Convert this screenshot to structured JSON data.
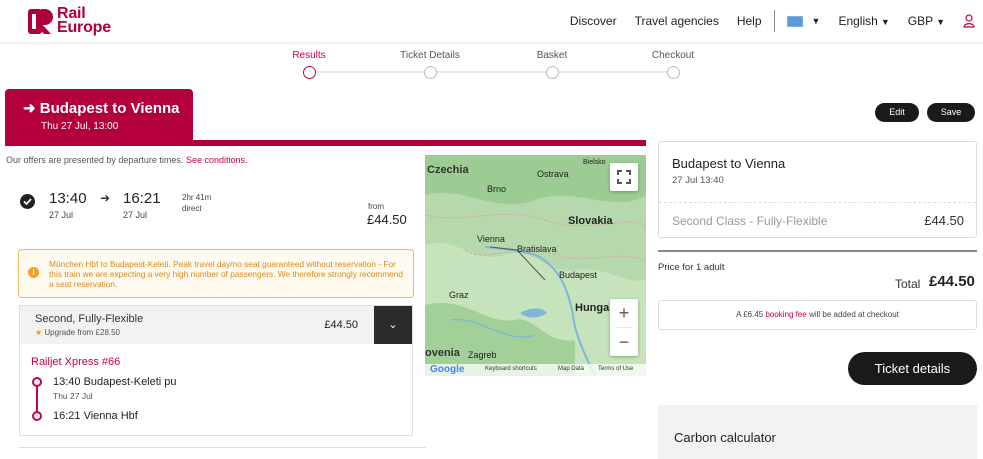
{
  "header": {
    "logo_line1": "Rail",
    "logo_line2": "Europe",
    "nav": [
      "Discover",
      "Travel agencies",
      "Help"
    ],
    "language": "English",
    "currency": "GBP"
  },
  "progress": {
    "steps": [
      "Results",
      "Ticket Details",
      "Basket",
      "Checkout"
    ],
    "active_index": 0
  },
  "journey": {
    "title": "Budapest to Vienna",
    "subtitle": "Thu 27 Jul, 13:00"
  },
  "offers_note": {
    "text": "Our offers are presented by departure times.",
    "link": "See conditions."
  },
  "train": {
    "dep_time": "13:40",
    "dep_date": "27 Jul",
    "arr_time": "16:21",
    "arr_date": "27 Jul",
    "duration": "2hr 41m",
    "type": "direct",
    "from_label": "from",
    "from_price": "£44.50"
  },
  "warning": {
    "text": "München Hbf to Budapest-Keleti. Peak travel day/no seat guaranteed without reservation - For this train we are expecting a very high number of passengers. We therefore strongly recommend a seat reservation."
  },
  "fare": {
    "class": "Second, Fully-Flexible",
    "upgrade": "Upgrade from £28.50",
    "price": "£44.50",
    "train_name": "Railjet Xpress #66",
    "stop1_time_station": "13:40  Budapest-Keleti pu",
    "stop1_date": "Thu 27 Jul",
    "stop2_time_station": "16:21  Vienna Hbf"
  },
  "map": {
    "labels": {
      "czechia": "Czechia",
      "brno": "Brno",
      "ostrava": "Ostrava",
      "bielsko": "Bielsko",
      "slovakia": "Slovakia",
      "vienna": "Vienna",
      "bratislava": "Bratislava",
      "budapest": "Budapest",
      "graz": "Graz",
      "hungary": "Hunga",
      "slovenia": "ovenia",
      "zagreb": "Zagreb"
    },
    "footer": {
      "google": "Google",
      "shortcuts": "Keyboard shortcuts",
      "mapdata": "Map Data",
      "terms": "Terms of Use"
    }
  },
  "actions": {
    "edit": "Edit",
    "save": "Save"
  },
  "summary": {
    "route": "Budapest to Vienna",
    "datetime": "27 Jul 13:40",
    "class": "Second Class - Fully-Flexible",
    "price": "£44.50"
  },
  "totals": {
    "price_for": "Price for 1 adult",
    "total_label": "Total",
    "total_value": "£44.50",
    "fee_prefix": "A £6.45",
    "fee_link": "booking fee",
    "fee_suffix": "will be added at checkout"
  },
  "ticket_button": "Ticket details",
  "carbon": "Carbon calculator"
}
